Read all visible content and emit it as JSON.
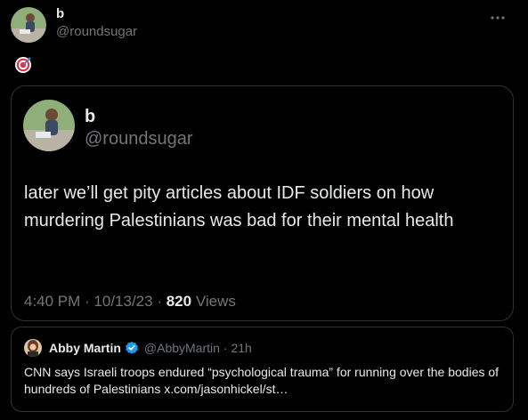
{
  "tweet": {
    "author": {
      "name": "b",
      "handle": "@roundsugar"
    },
    "body_emoji": "🎯",
    "more_icon": "ellipsis-icon"
  },
  "quoted_tweet": {
    "author": {
      "name": "b",
      "handle": "@roundsugar"
    },
    "text": "later we’ll get pity articles about IDF soldiers on how murdering Palestinians was bad for their mental health",
    "time": "4:40 PM",
    "sep1": " · ",
    "date": "10/13/23",
    "sep2": " · ",
    "views_count": "820",
    "views_label": " Views"
  },
  "nested_quote": {
    "author": {
      "name": "Abby Martin",
      "handle": "@AbbyMartin",
      "time": "· 21h"
    },
    "verified_icon": "verified-badge-icon",
    "text": "CNN says Israeli troops endured “psychological trauma” for running over the bodies of hundreds of Palestinians x.com/jasonhickel/st…"
  },
  "colors": {
    "background": "#000000",
    "primary_text": "#e7e9ea",
    "secondary_text": "#71767b",
    "border": "#2f3336",
    "verified": "#1d9bf0"
  }
}
